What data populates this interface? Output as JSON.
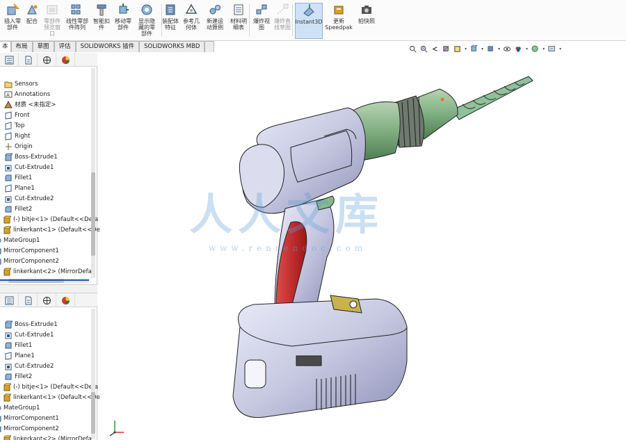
{
  "ribbon": {
    "buttons": [
      {
        "label": "插入零\n部件",
        "icon": "insert-component-icon",
        "disabled": false
      },
      {
        "label": "配合",
        "icon": "mate-icon",
        "disabled": false
      },
      {
        "label": "零部件\n预览窗\n口",
        "icon": "component-preview-icon",
        "disabled": true
      },
      {
        "label": "线性零部\n件阵列",
        "icon": "linear-pattern-icon",
        "disabled": false
      },
      {
        "label": "智能扣\n件",
        "icon": "smart-fastener-icon",
        "disabled": false
      },
      {
        "label": "移动零\n部件",
        "icon": "move-component-icon",
        "disabled": false
      },
      {
        "label": "显示隐\n藏的零\n部件",
        "icon": "show-hidden-icon",
        "disabled": false
      },
      {
        "label": "装配体\n特征",
        "icon": "assembly-feature-icon",
        "disabled": false
      },
      {
        "label": "参考几\n何体",
        "icon": "reference-geometry-icon",
        "disabled": false
      },
      {
        "label": "新建运\n动算例",
        "icon": "new-motion-study-icon",
        "disabled": false
      },
      {
        "label": "材料明\n细表",
        "icon": "bom-icon",
        "disabled": false
      },
      {
        "label": "爆炸视\n图",
        "icon": "exploded-view-icon",
        "disabled": false
      },
      {
        "label": "爆炸直\n线草图",
        "icon": "explode-line-sketch-icon",
        "disabled": true
      },
      {
        "label": "Instant3D",
        "icon": "instant3d-icon",
        "disabled": false,
        "active": true
      },
      {
        "label": "更新\nSpeedpak",
        "icon": "speedpak-icon",
        "disabled": false
      },
      {
        "label": "拍快照",
        "icon": "snapshot-icon",
        "disabled": false
      }
    ]
  },
  "cm_tabs": [
    "本",
    "布局",
    "草图",
    "评估",
    "SOLIDWORKS 插件",
    "SOLIDWORKS MBD",
    ""
  ],
  "pane1": {
    "tree": [
      {
        "label": "Sensors",
        "icon": "sensors-folder-icon"
      },
      {
        "label": "Annotations",
        "icon": "annotations-icon"
      },
      {
        "label": "材质 <未指定>",
        "icon": "material-icon"
      },
      {
        "label": "Front",
        "icon": "plane-icon"
      },
      {
        "label": "Top",
        "icon": "plane-icon"
      },
      {
        "label": "Right",
        "icon": "plane-icon"
      },
      {
        "label": "Origin",
        "icon": "origin-icon"
      },
      {
        "label": "Boss-Extrude1",
        "icon": "boss-extrude-icon"
      },
      {
        "label": "Cut-Extrude1",
        "icon": "cut-extrude-icon"
      },
      {
        "label": "Fillet1",
        "icon": "fillet-icon"
      },
      {
        "label": "Plane1",
        "icon": "plane-icon"
      },
      {
        "label": "Cut-Extrude2",
        "icon": "cut-extrude-icon"
      },
      {
        "label": "Fillet2",
        "icon": "fillet-icon"
      },
      {
        "label": "(-) bitje<1> (Default<<Defa",
        "icon": "part-icon"
      },
      {
        "label": "linkerkant<1> (Default<<De",
        "icon": "part-icon"
      },
      {
        "label": "MateGroup1",
        "icon": "mategroup-icon"
      },
      {
        "label": "MirrorComponent1",
        "icon": "mirror-icon"
      },
      {
        "label": "MirrorComponent2",
        "icon": "mirror-icon"
      },
      {
        "label": "linkerkant<2> (MirrorDefau",
        "icon": "part-icon"
      }
    ]
  },
  "pane2": {
    "tree": [
      {
        "label": "Boss-Extrude1",
        "icon": "boss-extrude-icon"
      },
      {
        "label": "Cut-Extrude1",
        "icon": "cut-extrude-icon"
      },
      {
        "label": "Fillet1",
        "icon": "fillet-icon"
      },
      {
        "label": "Plane1",
        "icon": "plane-icon"
      },
      {
        "label": "Cut-Extrude2",
        "icon": "cut-extrude-icon"
      },
      {
        "label": "Fillet2",
        "icon": "fillet-icon"
      },
      {
        "label": "(-) bitje<1> (Default<<Defa",
        "icon": "part-icon"
      },
      {
        "label": "linkerkant<1> (Default<<De",
        "icon": "part-icon"
      },
      {
        "label": "MateGroup1",
        "icon": "mategroup-icon"
      },
      {
        "label": "MirrorComponent1",
        "icon": "mirror-icon"
      },
      {
        "label": "MirrorComponent2",
        "icon": "mirror-icon"
      },
      {
        "label": "linkerkant<2> (MirrorDefa",
        "icon": "part-icon"
      }
    ]
  },
  "hud_icons": [
    "zoom-to-fit-icon",
    "zoom-to-area-icon",
    "previous-view-icon",
    "section-view-icon",
    "dynamic-annotation-icon",
    "view-orientation-icon",
    "display-style-icon",
    "hide-show-items-icon",
    "edit-appearance-icon",
    "apply-scene-icon",
    "view-settings-icon"
  ],
  "fm_tabs": [
    "feature-manager-icon",
    "property-manager-icon",
    "configuration-manager-icon",
    "display-manager-icon"
  ],
  "watermark": {
    "main": "人人文库",
    "url": "www.renrendoc.com"
  },
  "colors": {
    "drill_body": "#c9cbe3",
    "drill_green": "#7fae80",
    "grip_red": "#c8262a",
    "accent": "#1f5ca8"
  }
}
